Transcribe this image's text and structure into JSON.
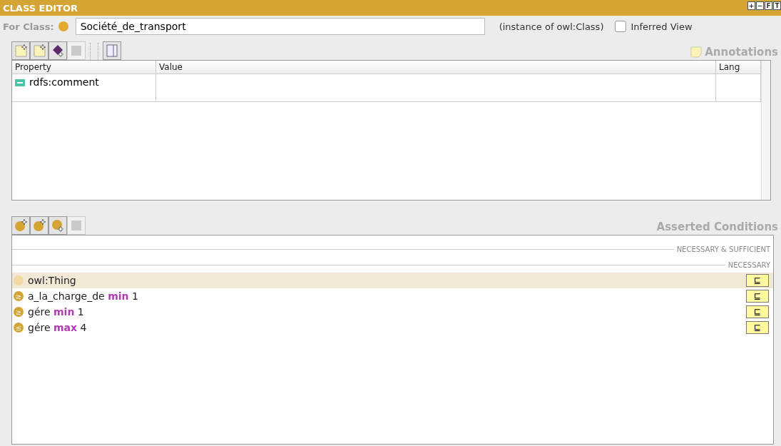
{
  "window": {
    "title": "CLASS EDITOR",
    "buttons": [
      "+",
      "−",
      "F",
      "T"
    ]
  },
  "class_row": {
    "label": "For Class:",
    "value": "Société_de_transport",
    "instance_of": "(instance of owl:Class)",
    "inferred_view": {
      "label": "Inferred View",
      "checked": false
    }
  },
  "annotations": {
    "title": "Annotations",
    "toolbar": [
      {
        "kind": "note-add",
        "disabled": false
      },
      {
        "kind": "doc-add",
        "disabled": false
      },
      {
        "kind": "diamond-add",
        "disabled": false
      },
      {
        "kind": "delete",
        "disabled": true
      },
      {
        "kind": "separator"
      },
      {
        "kind": "panel",
        "disabled": false
      }
    ],
    "columns": [
      "Property",
      "Value",
      "Lang"
    ],
    "rows": [
      {
        "property": "rdfs:comment",
        "value": "",
        "lang": ""
      }
    ]
  },
  "conditions": {
    "title": "Asserted Conditions",
    "toolbar": [
      {
        "kind": "u-add",
        "disabled": false
      },
      {
        "kind": "r-add",
        "disabled": false
      },
      {
        "kind": "circle-add",
        "disabled": false
      },
      {
        "kind": "delete",
        "disabled": true
      }
    ],
    "sections": [
      {
        "heading": "NECESSARY & SUFFICIENT"
      },
      {
        "heading": "NECESSARY",
        "items": [
          {
            "kind": "class",
            "text": "owl:Thing",
            "button": "⊑",
            "selected": true
          },
          {
            "kind": "restriction",
            "text": "a_la_charge_de **min** 1",
            "symbol": "≥",
            "button": "⊑",
            "selected": false
          },
          {
            "kind": "restriction",
            "text": "gére **min** 1",
            "symbol": "≥",
            "button": "⊑",
            "selected": false
          },
          {
            "kind": "restriction",
            "text": "gére **max** 4",
            "symbol": "≤",
            "button": "⊑",
            "selected": false
          }
        ]
      }
    ]
  }
}
